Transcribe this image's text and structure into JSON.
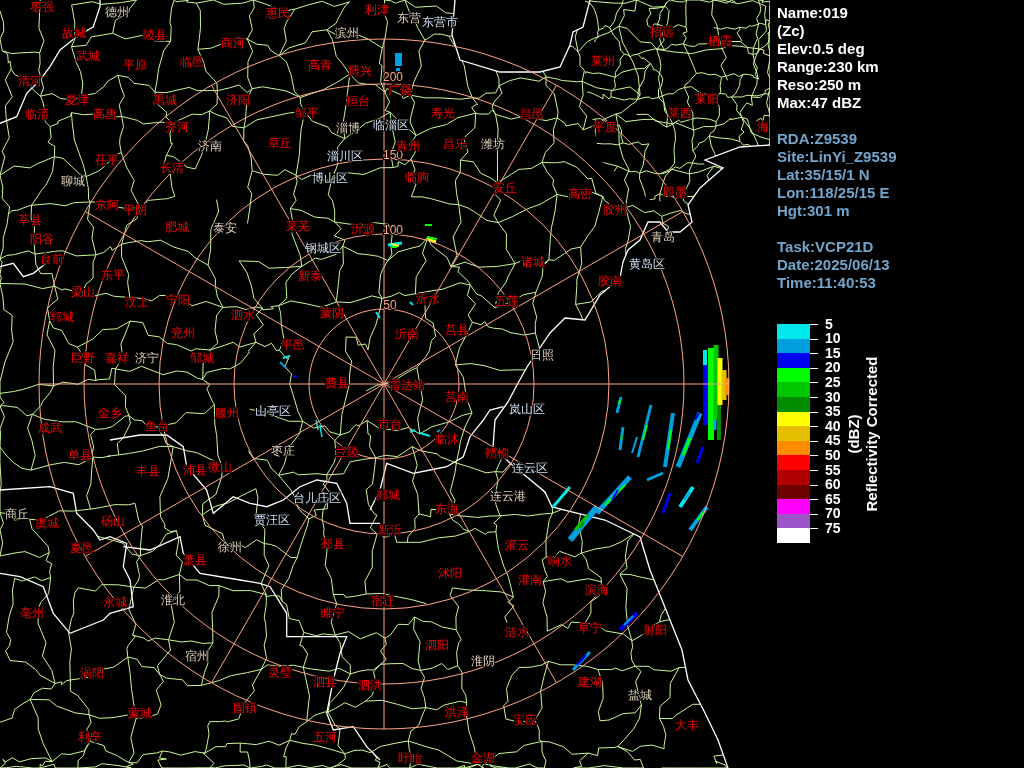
{
  "map": {
    "range_labels": [
      "200",
      "150",
      "100",
      "50"
    ],
    "places": [
      {
        "name": "枣强",
        "kind": "county"
      },
      {
        "name": "德州",
        "kind": "city"
      },
      {
        "name": "惠民",
        "kind": "county"
      },
      {
        "name": "利津",
        "kind": "county"
      },
      {
        "name": "东营",
        "kind": "city"
      },
      {
        "name": "东营市",
        "kind": "district"
      },
      {
        "name": "故城",
        "kind": "county"
      },
      {
        "name": "陵县",
        "kind": "county"
      },
      {
        "name": "滨州",
        "kind": "city"
      },
      {
        "name": "招远",
        "kind": "county"
      },
      {
        "name": "商河",
        "kind": "county"
      },
      {
        "name": "栖霞",
        "kind": "county"
      },
      {
        "name": "武城",
        "kind": "county"
      },
      {
        "name": "平原",
        "kind": "county"
      },
      {
        "name": "临邑",
        "kind": "county"
      },
      {
        "name": "高青",
        "kind": "county"
      },
      {
        "name": "莱州",
        "kind": "county"
      },
      {
        "name": "博兴",
        "kind": "county"
      },
      {
        "name": "清河",
        "kind": "county"
      },
      {
        "name": "广饶",
        "kind": "county"
      },
      {
        "name": "夏津",
        "kind": "county"
      },
      {
        "name": "禹城",
        "kind": "county"
      },
      {
        "name": "济阳",
        "kind": "county"
      },
      {
        "name": "桓台",
        "kind": "county"
      },
      {
        "name": "莱阳",
        "kind": "county"
      },
      {
        "name": "临清",
        "kind": "county"
      },
      {
        "name": "高唐",
        "kind": "county"
      },
      {
        "name": "邹平",
        "kind": "county"
      },
      {
        "name": "寿光",
        "kind": "county"
      },
      {
        "name": "昌邑",
        "kind": "county"
      },
      {
        "name": "莱西",
        "kind": "county"
      },
      {
        "name": "齐河",
        "kind": "county"
      },
      {
        "name": "淄博",
        "kind": "city"
      },
      {
        "name": "临淄区",
        "kind": "district"
      },
      {
        "name": "平度",
        "kind": "county"
      },
      {
        "name": "海",
        "kind": "county"
      },
      {
        "name": "济南",
        "kind": "city"
      },
      {
        "name": "章丘",
        "kind": "county"
      },
      {
        "name": "青州",
        "kind": "county"
      },
      {
        "name": "昌乐",
        "kind": "county"
      },
      {
        "name": "潍坊",
        "kind": "city"
      },
      {
        "name": "茌平",
        "kind": "county"
      },
      {
        "name": "淄川区",
        "kind": "district"
      },
      {
        "name": "长清",
        "kind": "county"
      },
      {
        "name": "聊城",
        "kind": "city"
      },
      {
        "name": "博山区",
        "kind": "district"
      },
      {
        "name": "临朐",
        "kind": "county"
      },
      {
        "name": "安丘",
        "kind": "county"
      },
      {
        "name": "高密",
        "kind": "county"
      },
      {
        "name": "即墨",
        "kind": "county"
      },
      {
        "name": "东阿",
        "kind": "county"
      },
      {
        "name": "平阴",
        "kind": "county"
      },
      {
        "name": "胶州",
        "kind": "county"
      },
      {
        "name": "莘县",
        "kind": "county"
      },
      {
        "name": "肥城",
        "kind": "county"
      },
      {
        "name": "泰安",
        "kind": "city"
      },
      {
        "name": "莱芜",
        "kind": "county"
      },
      {
        "name": "沂源",
        "kind": "county"
      },
      {
        "name": "阳谷",
        "kind": "county"
      },
      {
        "name": "青岛",
        "kind": "city"
      },
      {
        "name": "钢城区",
        "kind": "district"
      },
      {
        "name": "台前",
        "kind": "county"
      },
      {
        "name": "诸城",
        "kind": "county"
      },
      {
        "name": "黄岛区",
        "kind": "district"
      },
      {
        "name": "东平",
        "kind": "county"
      },
      {
        "name": "新泰",
        "kind": "county"
      },
      {
        "name": "胶南",
        "kind": "county"
      },
      {
        "name": "梁山",
        "kind": "county"
      },
      {
        "name": "汶上",
        "kind": "county"
      },
      {
        "name": "宁阳",
        "kind": "county"
      },
      {
        "name": "沂水",
        "kind": "county"
      },
      {
        "name": "五莲",
        "kind": "county"
      },
      {
        "name": "郓城",
        "kind": "county"
      },
      {
        "name": "泗水",
        "kind": "county"
      },
      {
        "name": "蒙阴",
        "kind": "county"
      },
      {
        "name": "兖州",
        "kind": "county"
      },
      {
        "name": "沂南",
        "kind": "county"
      },
      {
        "name": "莒县",
        "kind": "county"
      },
      {
        "name": "平邑",
        "kind": "county"
      },
      {
        "name": "巨野",
        "kind": "county"
      },
      {
        "name": "嘉祥",
        "kind": "county"
      },
      {
        "name": "济宁",
        "kind": "city"
      },
      {
        "name": "邹城",
        "kind": "county"
      },
      {
        "name": "日照",
        "kind": "city"
      },
      {
        "name": "费县",
        "kind": "county"
      },
      {
        "name": "雷达站",
        "kind": "county"
      },
      {
        "name": "莒南",
        "kind": "county"
      },
      {
        "name": "金乡",
        "kind": "county"
      },
      {
        "name": "滕州",
        "kind": "county"
      },
      {
        "name": "山亭区",
        "kind": "district"
      },
      {
        "name": "岚山区",
        "kind": "district"
      },
      {
        "name": "成武",
        "kind": "county"
      },
      {
        "name": "鱼台",
        "kind": "county"
      },
      {
        "name": "市台",
        "kind": "county"
      },
      {
        "name": "临沭",
        "kind": "county"
      },
      {
        "name": "单县",
        "kind": "county"
      },
      {
        "name": "枣庄",
        "kind": "city"
      },
      {
        "name": "兰陵",
        "kind": "county"
      },
      {
        "name": "赣榆",
        "kind": "county"
      },
      {
        "name": "丰县",
        "kind": "county"
      },
      {
        "name": "沛县",
        "kind": "county"
      },
      {
        "name": "微山",
        "kind": "county"
      },
      {
        "name": "连云区",
        "kind": "district"
      },
      {
        "name": "台儿庄区",
        "kind": "district"
      },
      {
        "name": "郯城",
        "kind": "county"
      },
      {
        "name": "连云港",
        "kind": "city"
      },
      {
        "name": "商丘",
        "kind": "city"
      },
      {
        "name": "东海",
        "kind": "county"
      },
      {
        "name": "虞城",
        "kind": "county"
      },
      {
        "name": "砀山",
        "kind": "county"
      },
      {
        "name": "贾汪区",
        "kind": "district"
      },
      {
        "name": "新沂",
        "kind": "county"
      },
      {
        "name": "夏邑",
        "kind": "county"
      },
      {
        "name": "徐州",
        "kind": "city"
      },
      {
        "name": "邳县",
        "kind": "county"
      },
      {
        "name": "灌云",
        "kind": "county"
      },
      {
        "name": "萧县",
        "kind": "county"
      },
      {
        "name": "响水",
        "kind": "county"
      },
      {
        "name": "沭阳",
        "kind": "county"
      },
      {
        "name": "灌南",
        "kind": "county"
      },
      {
        "name": "滨海",
        "kind": "county"
      },
      {
        "name": "永城",
        "kind": "county"
      },
      {
        "name": "淮北",
        "kind": "city"
      },
      {
        "name": "宿迁",
        "kind": "county"
      },
      {
        "name": "亳州",
        "kind": "county"
      },
      {
        "name": "睢宁",
        "kind": "county"
      },
      {
        "name": "涟水",
        "kind": "county"
      },
      {
        "name": "阜宁",
        "kind": "county"
      },
      {
        "name": "射阳",
        "kind": "county"
      },
      {
        "name": "泗阳",
        "kind": "county"
      },
      {
        "name": "宿州",
        "kind": "city"
      },
      {
        "name": "淮阴",
        "kind": "city"
      },
      {
        "name": "涡阳",
        "kind": "county"
      },
      {
        "name": "灵璧",
        "kind": "county"
      },
      {
        "name": "泗县",
        "kind": "county"
      },
      {
        "name": "泗洪",
        "kind": "county"
      },
      {
        "name": "建湖",
        "kind": "county"
      },
      {
        "name": "盐城",
        "kind": "city"
      },
      {
        "name": "蒙城",
        "kind": "county"
      },
      {
        "name": "固镇",
        "kind": "county"
      },
      {
        "name": "洪泽",
        "kind": "county"
      },
      {
        "name": "宝应",
        "kind": "county"
      },
      {
        "name": "大丰",
        "kind": "county"
      },
      {
        "name": "利辛",
        "kind": "county"
      },
      {
        "name": "五河",
        "kind": "county"
      },
      {
        "name": "盱眙",
        "kind": "county"
      },
      {
        "name": "金湖",
        "kind": "county"
      }
    ]
  },
  "product_info": [
    "Name:019",
    "(Zc)",
    "Elev:0.5 deg",
    "Range:230 km",
    "Reso:250 m",
    "Max:47 dBZ"
  ],
  "site_info": [
    "RDA:Z9539",
    "Site:LinYi_Z9539",
    "Lat:35/15/1 N",
    "Lon:118/25/15 E",
    "Hgt:301 m"
  ],
  "scan_info": [
    "Task:VCP21D",
    "Date:2025/06/13",
    "Time:11:40:53"
  ],
  "legend": {
    "unit": "(dBZ)",
    "title": "Reflectivity Corrected",
    "items": [
      {
        "label": "5",
        "color": "#00e8ec"
      },
      {
        "label": "10",
        "color": "#00a0e0"
      },
      {
        "label": "15",
        "color": "#0000f0"
      },
      {
        "label": "20",
        "color": "#00ff00"
      },
      {
        "label": "25",
        "color": "#00c800"
      },
      {
        "label": "30",
        "color": "#008c00"
      },
      {
        "label": "35",
        "color": "#ffff00"
      },
      {
        "label": "40",
        "color": "#e6be00"
      },
      {
        "label": "45",
        "color": "#ff8c00"
      },
      {
        "label": "50",
        "color": "#ff0000"
      },
      {
        "label": "55",
        "color": "#b00000"
      },
      {
        "label": "60",
        "color": "#6e0000"
      },
      {
        "label": "65",
        "color": "#ff00ff"
      },
      {
        "label": "70",
        "color": "#9b55c8"
      },
      {
        "label": "75",
        "color": "#ffffff"
      }
    ]
  }
}
